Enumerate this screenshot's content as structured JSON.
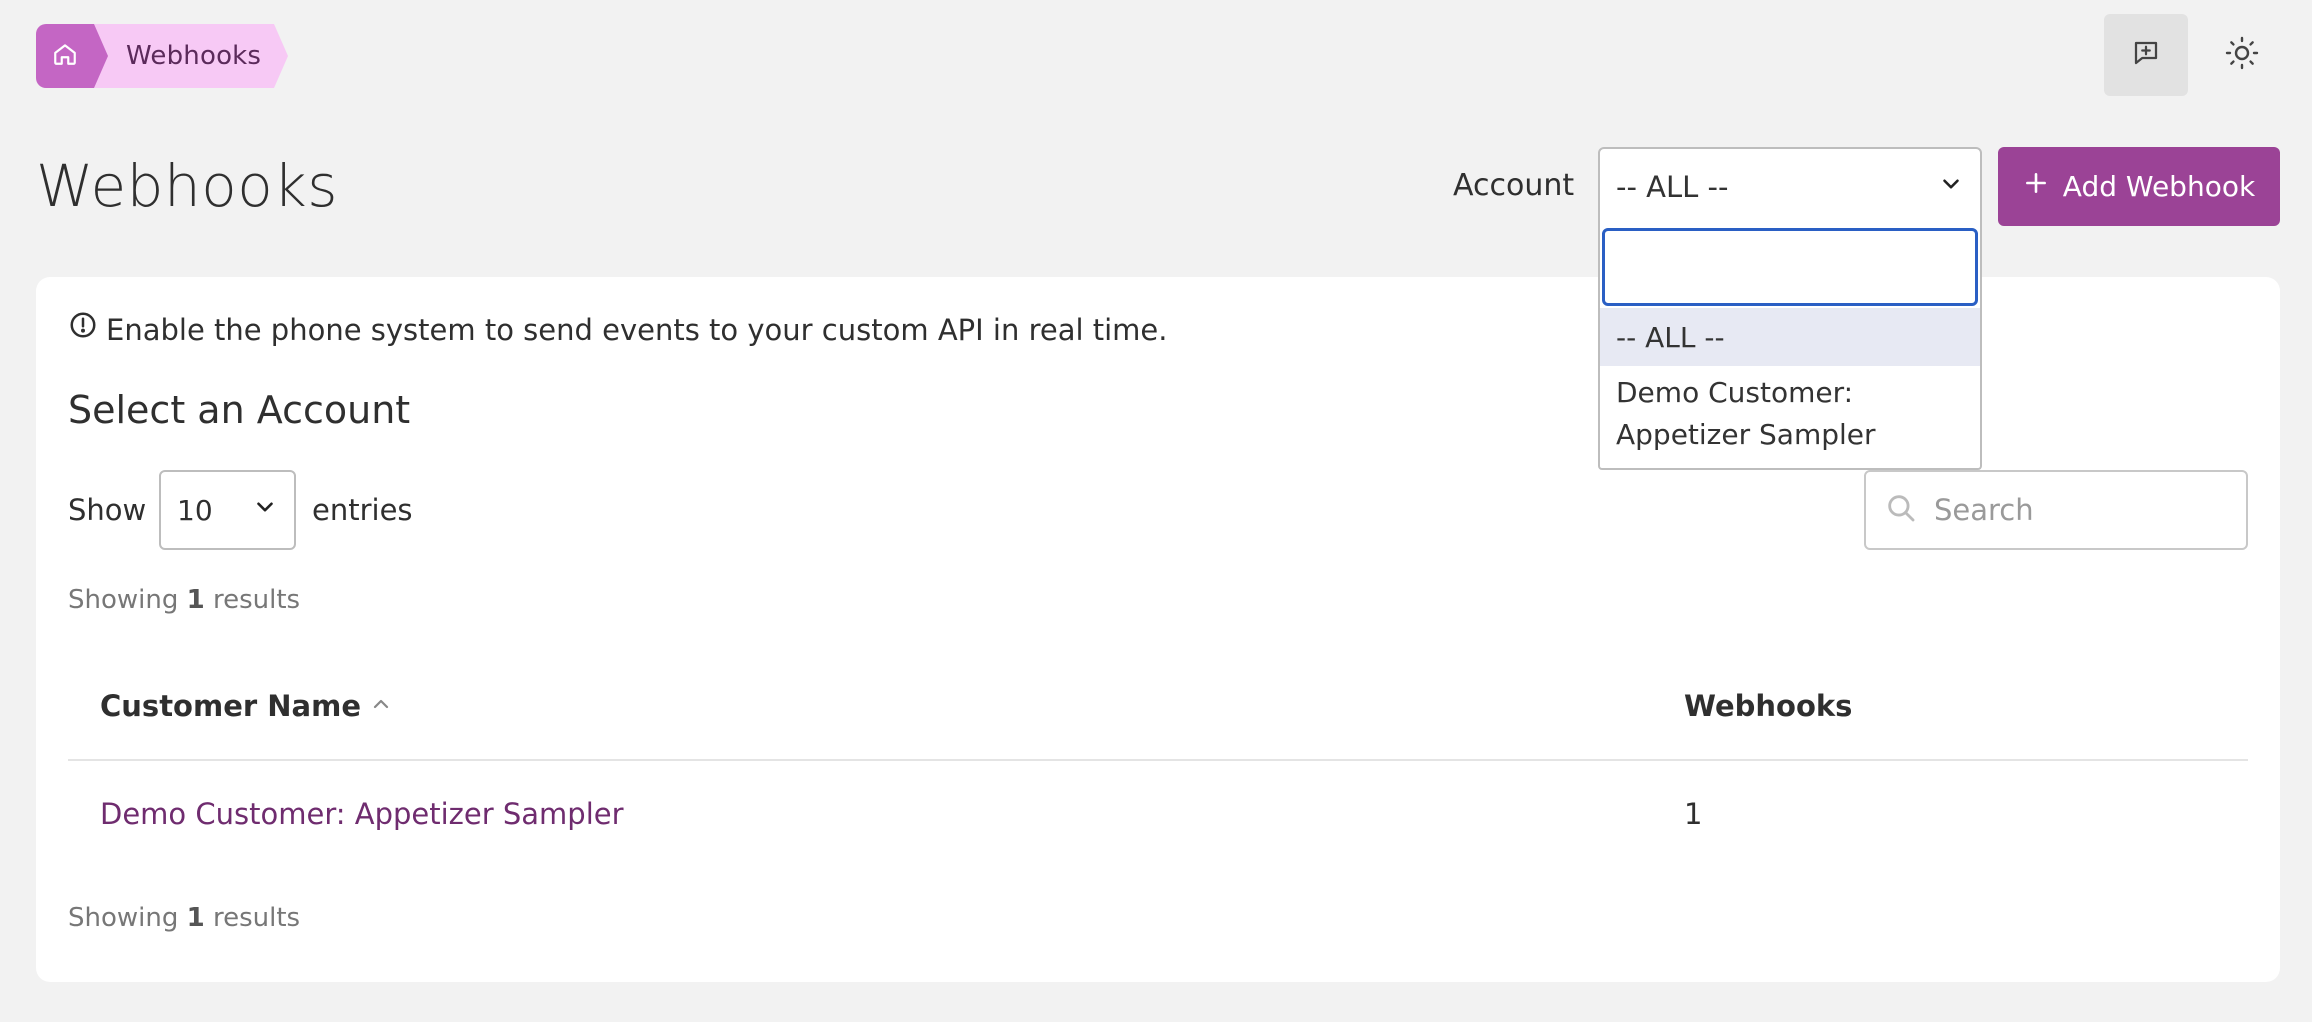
{
  "breadcrumb": {
    "home_icon": "home-icon",
    "current": "Webhooks"
  },
  "header_icons": {
    "feedback_icon": "message-plus-icon",
    "theme_icon": "sun-icon"
  },
  "page": {
    "title": "Webhooks"
  },
  "account_filter": {
    "label": "Account",
    "selected": "-- ALL --",
    "dropdown": {
      "search_value": "",
      "options": [
        "-- ALL --",
        "Demo Customer: Appetizer Sampler"
      ],
      "highlighted": "-- ALL --"
    }
  },
  "add_button": {
    "label": "Add Webhook"
  },
  "card": {
    "info_text": "Enable the phone system to send events to your custom API in real time.",
    "title": "Select an Account",
    "show_label": "Show",
    "entries_value": "10",
    "entries_label": "entries",
    "search_placeholder": "Search",
    "showing_prefix": "Showing",
    "showing_count": "1",
    "showing_suffix": "results"
  },
  "table": {
    "columns": [
      "Customer Name",
      "Webhooks"
    ],
    "rows": [
      {
        "customer_name": "Demo Customer: Appetizer Sampler",
        "webhooks": "1"
      }
    ]
  },
  "colors": {
    "accent": "#9b4396",
    "breadcrumb_home": "#c466c4",
    "breadcrumb_page": "#f7c9f5",
    "link": "#6f2c6f",
    "focus": "#2a5fc4"
  }
}
